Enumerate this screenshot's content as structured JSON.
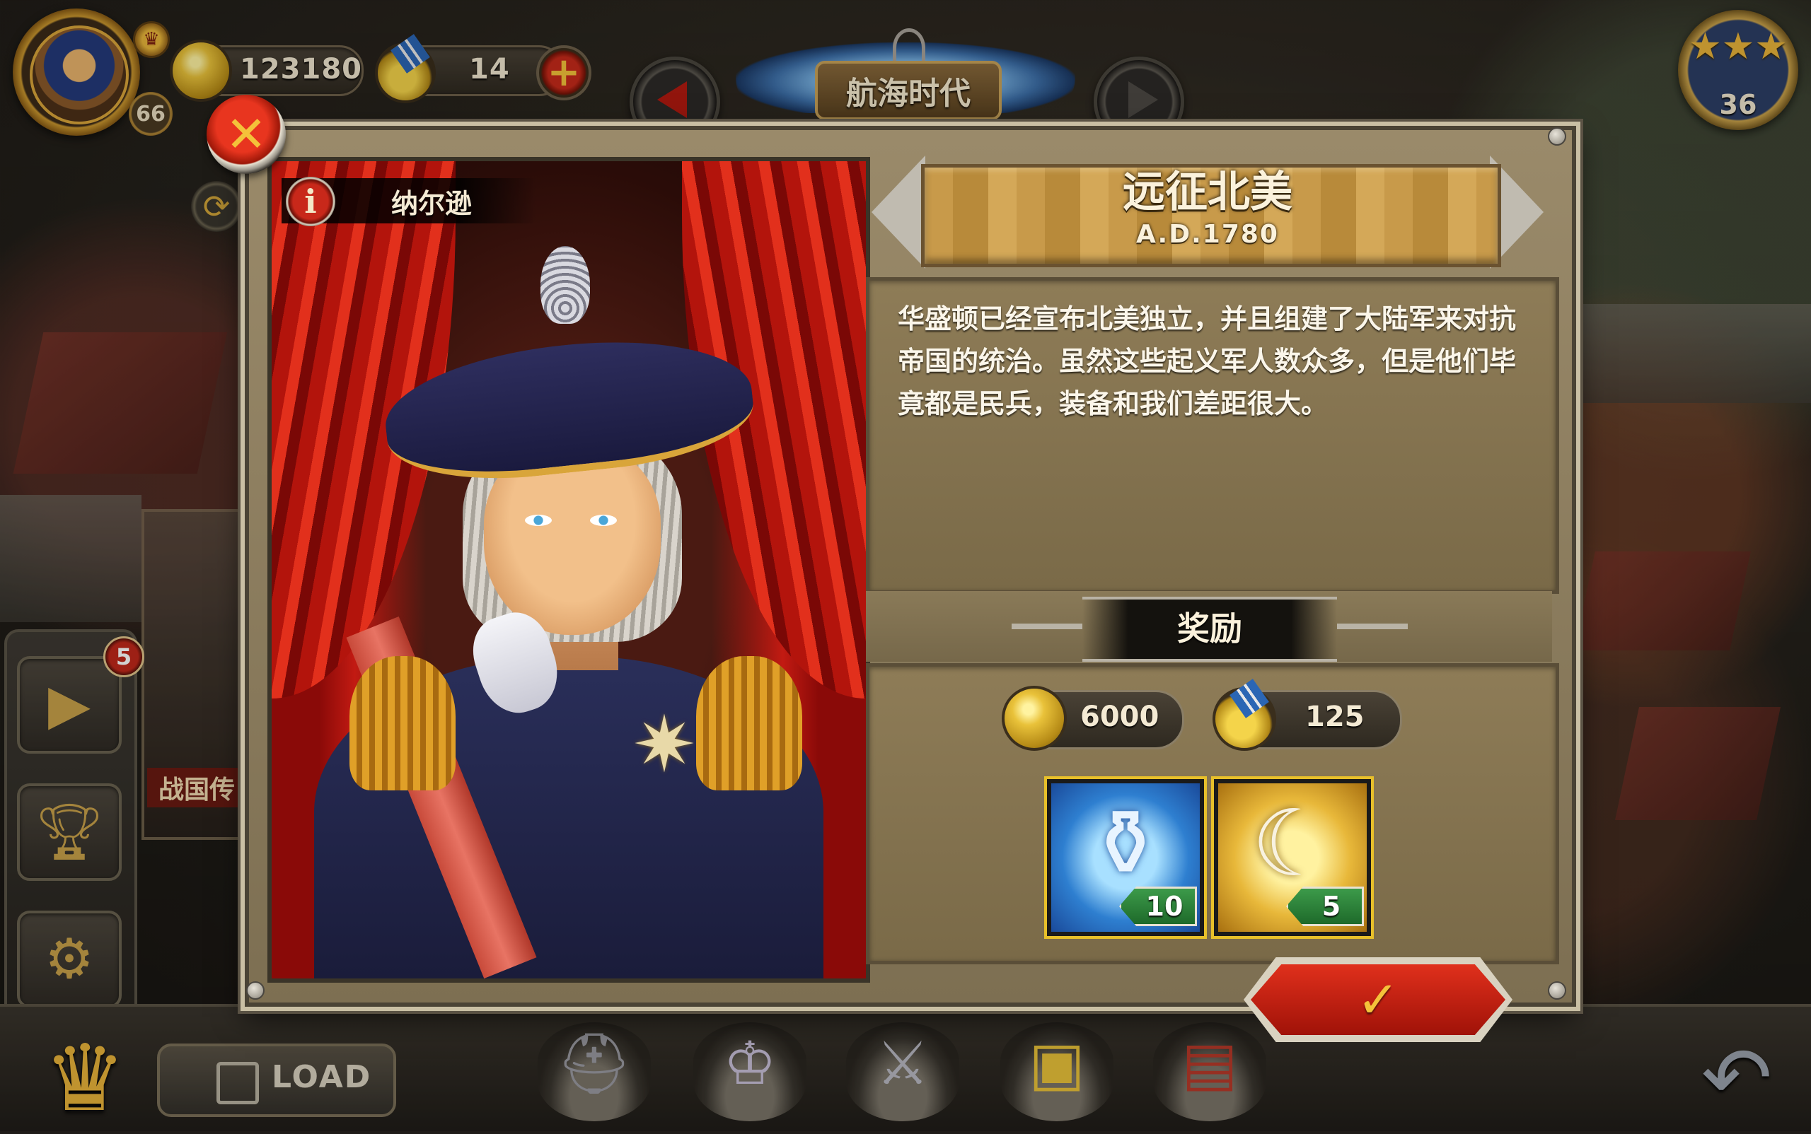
{
  "hud": {
    "player_level": "66",
    "gold": "123180",
    "medals": "14",
    "plus_label": "+",
    "era_title": "航海时代",
    "stars": "36",
    "star_glyphs": "★★★"
  },
  "sidebar": {
    "notification_count": "5",
    "card_label": "战国传"
  },
  "dialog": {
    "close_label": "✕",
    "general_name": "纳尔逊",
    "info_label": "i",
    "mission_title": "远征北美",
    "mission_date": "A.D.1780",
    "description": "华盛顿已经宣布北美独立，并且组建了大陆军来对抗帝国的统治。虽然这些起义军人数众多，但是他们毕竟都是民兵，装备和我们差距很大。",
    "reward_heading": "奖励",
    "reward_gold": "6000",
    "reward_medals": "125",
    "items": [
      {
        "icon": "porcelain-vase-icon",
        "glyph": "⚱",
        "count": "10"
      },
      {
        "icon": "ivory-horn-icon",
        "glyph": "☾",
        "count": "5"
      }
    ],
    "confirm_label": "✓"
  },
  "bottom": {
    "load_label": "LOAD"
  },
  "colors": {
    "gold_accent": "#e9b43a",
    "confirm_red": "#c62a1a",
    "panel_brown": "#8e7c57"
  }
}
